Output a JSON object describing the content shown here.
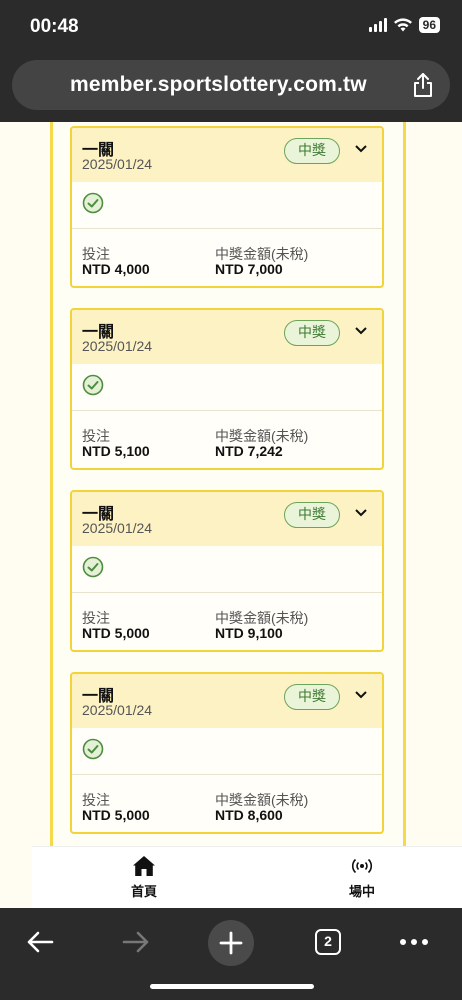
{
  "status_bar": {
    "time": "00:48",
    "battery": "96"
  },
  "browser": {
    "url": "member.sportslottery.com.tw",
    "tab_count": "2"
  },
  "cards": [
    {
      "title": "一關",
      "date": "2025/01/24",
      "status": "中獎",
      "stake_label": "投注",
      "stake": "NTD 4,000",
      "payout_label": "中獎金額(未稅)",
      "payout": "NTD 7,000"
    },
    {
      "title": "一關",
      "date": "2025/01/24",
      "status": "中獎",
      "stake_label": "投注",
      "stake": "NTD 5,100",
      "payout_label": "中獎金額(未稅)",
      "payout": "NTD 7,242"
    },
    {
      "title": "一關",
      "date": "2025/01/24",
      "status": "中獎",
      "stake_label": "投注",
      "stake": "NTD 5,000",
      "payout_label": "中獎金額(未稅)",
      "payout": "NTD 9,100"
    },
    {
      "title": "一關",
      "date": "2025/01/24",
      "status": "中獎",
      "stake_label": "投注",
      "stake": "NTD 5,000",
      "payout_label": "中獎金額(未稅)",
      "payout": "NTD 8,600"
    }
  ],
  "bottom_nav": {
    "home_label": "首頁",
    "live_label": "場中"
  },
  "icons": {
    "home": "home-icon",
    "live": "broadcast-icon",
    "check": "check-circle-icon",
    "chevron": "chevron-down-icon",
    "share": "share-icon"
  },
  "colors": {
    "accent_yellow": "#f2d33a",
    "card_header": "#fdf2c4",
    "win_green": "#3f7a33"
  }
}
